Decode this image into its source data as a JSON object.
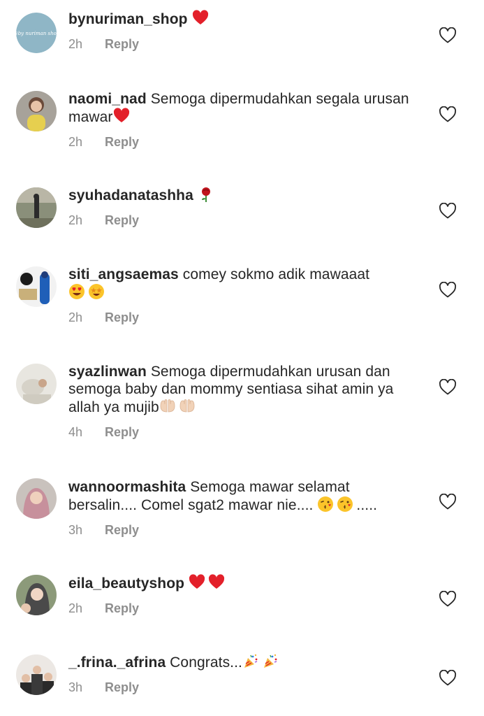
{
  "colors": {
    "text": "#262626",
    "meta": "#8e8e8e",
    "heart_emoji": "#e3202a"
  },
  "avatar_text": "@by nuriman shop",
  "comments": [
    {
      "username": "bynuriman_shop",
      "text": "",
      "time": "2h",
      "reply": "Reply",
      "emojis": [
        "red-heart"
      ]
    },
    {
      "username": "naomi_nad",
      "text": "Semoga dipermudahkan segala urusan mawar",
      "time": "2h",
      "reply": "Reply",
      "emojis": [
        "red-heart"
      ]
    },
    {
      "username": "syuhadanatashha",
      "text": "",
      "time": "2h",
      "reply": "Reply",
      "emojis": [
        "rose"
      ]
    },
    {
      "username": "siti_angsaemas",
      "text": "comey sokmo adik mawaaat",
      "time": "2h",
      "reply": "Reply",
      "emojis": [
        "heart-eyes",
        "star-struck"
      ]
    },
    {
      "username": "syazlinwan",
      "text": "Semoga dipermudahkan urusan dan semoga baby dan mommy sentiasa sihat amin ya allah ya mujib",
      "time": "4h",
      "reply": "Reply",
      "emojis": [
        "palms-up-together",
        "palms-up-together"
      ]
    },
    {
      "username": "wannoormashita",
      "text": "Semoga mawar selamat bersalin.... Comel sgat2 mawar nie....",
      "text_tail": ".....",
      "time": "3h",
      "reply": "Reply",
      "emojis": [
        "kissing-heart",
        "kissing-heart"
      ]
    },
    {
      "username": "eila_beautyshop",
      "text": "",
      "time": "2h",
      "reply": "Reply",
      "emojis": [
        "red-heart",
        "red-heart"
      ]
    },
    {
      "username": "_.frina._afrina",
      "text": "Congrats...",
      "time": "3h",
      "reply": "Reply",
      "emojis": [
        "party-popper",
        "party-popper"
      ]
    }
  ]
}
